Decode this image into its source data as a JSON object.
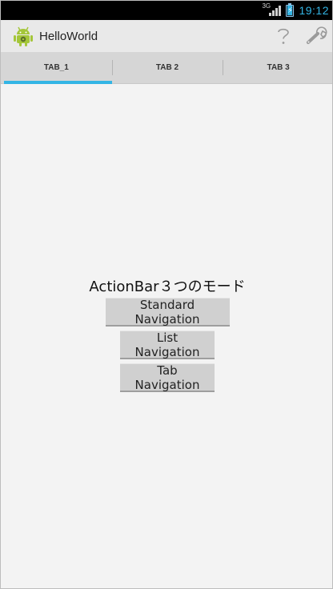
{
  "status_bar": {
    "network": "3G",
    "time": "19:12",
    "battery_level": 0.85
  },
  "action_bar": {
    "title": "HelloWorld",
    "icons": [
      "android-icon",
      "help-icon",
      "settings-wrench-icon"
    ]
  },
  "tabs": [
    {
      "label": "TAB_1",
      "selected": true
    },
    {
      "label": "TAB 2",
      "selected": false
    },
    {
      "label": "TAB 3",
      "selected": false
    }
  ],
  "content": {
    "label": "ActionBar３つのモード",
    "buttons": {
      "standard": "Standard Navigation",
      "list": "List Navigation",
      "tab": "Tab Navigation"
    }
  },
  "colors": {
    "accent": "#33b5e5",
    "status_bar_bg": "#000000",
    "action_bar_bg": "#e9e9e9",
    "tab_bar_bg": "#d6d6d6",
    "content_bg": "#f3f3f3",
    "button_bg": "#d0d0d0"
  }
}
